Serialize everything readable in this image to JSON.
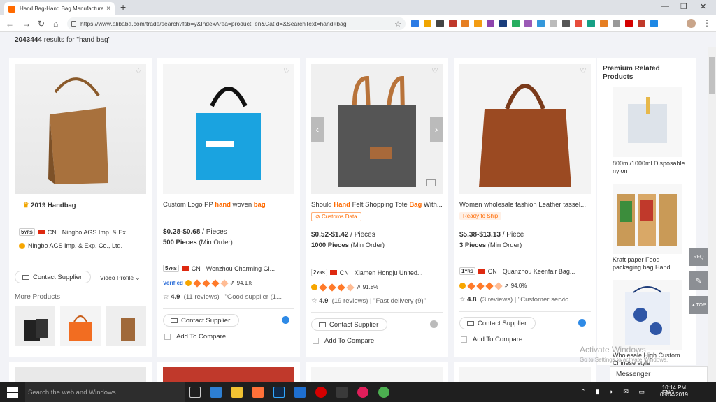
{
  "browser": {
    "tab_title": "Hand Bag-Hand Bag Manufacture",
    "url": "https://www.alibaba.com/trade/search?fsb=y&IndexArea=product_en&CatId=&SearchText=hand+bag"
  },
  "results": {
    "count": "2043444",
    "text": " results for \"hand bag\""
  },
  "card1": {
    "badge": "2019 Handbag",
    "years": "5",
    "country": "CN",
    "supplier": "Ningbo AGS Imp. & Ex...",
    "supplier_full": "Ningbo AGS Imp. & Exp. Co., Ltd.",
    "contact": "Contact Supplier",
    "video": "Video Profile",
    "more": "More Products"
  },
  "products": [
    {
      "title_pre": "Custom Logo PP ",
      "title_k1": "hand",
      "title_mid": " woven ",
      "title_k2": "bag",
      "title_post": "",
      "price": "$0.28-$0.68",
      "unit": " / Pieces",
      "moq": "500 Pieces",
      "moq_label": " (Min Order)",
      "years": "5",
      "country": "CN",
      "supplier": "Wenzhou Charming Gi...",
      "verified": "Verified",
      "response": "94.1%",
      "rating": "4.9",
      "reviews": "(11 reviews)",
      "quote": "\"Good supplier (1...",
      "contact": "Contact Supplier",
      "compare": "Add To Compare"
    },
    {
      "title_pre": "Should ",
      "title_k1": "Hand",
      "title_mid": " Felt Shopping Tote ",
      "title_k2": "Bag",
      "title_post": " With...",
      "tag": "Customs Data",
      "price": "$0.52-$1.42",
      "unit": " / Pieces",
      "moq": "1000 Pieces",
      "moq_label": " (Min Order)",
      "years": "2",
      "country": "CN",
      "supplier": "Xiamen Hongju United...",
      "response": "91.8%",
      "rating": "4.9",
      "reviews": "(19 reviews)",
      "quote": "\"Fast delivery (9)\"",
      "contact": "Contact Supplier",
      "compare": "Add To Compare"
    },
    {
      "title_pre": "Women wholesale fashion Leather tassel...",
      "title_k1": "",
      "title_mid": "",
      "title_k2": "",
      "title_post": "",
      "tag": "Ready to Ship",
      "price": "$5.38-$13.13",
      "unit": " / Piece",
      "moq": "3 Pieces",
      "moq_label": " (Min Order)",
      "years": "1",
      "country": "CN",
      "supplier": "Quanzhou Keenfair Bag...",
      "response": "94.0%",
      "rating": "4.8",
      "reviews": "(3 reviews)",
      "quote": "\"Customer servic...",
      "contact": "Contact Supplier",
      "compare": "Add To Compare"
    }
  ],
  "sidebar": {
    "heading": "Premium Related Products",
    "items": [
      {
        "name": "800ml/1000ml Disposable nylon"
      },
      {
        "name": "Kraft paper Food packaging bag Hand"
      },
      {
        "name": "Wholesale High Custom Chinese style"
      }
    ]
  },
  "float": {
    "rfq": "RFQ",
    "top": "TOP"
  },
  "windows": {
    "activate": "Activate Windows",
    "activate_sub": "Go to Settings to activate Windows.",
    "messenger": "Messenger",
    "search": "Search the web and Windows",
    "time": "10:14 PM",
    "date": "08/04/2019",
    "lang": "ENG"
  },
  "colors": {
    "accent": "#ff6a00",
    "page_bg": "#f2f3f7",
    "taskbar": "#1f1f1f"
  }
}
